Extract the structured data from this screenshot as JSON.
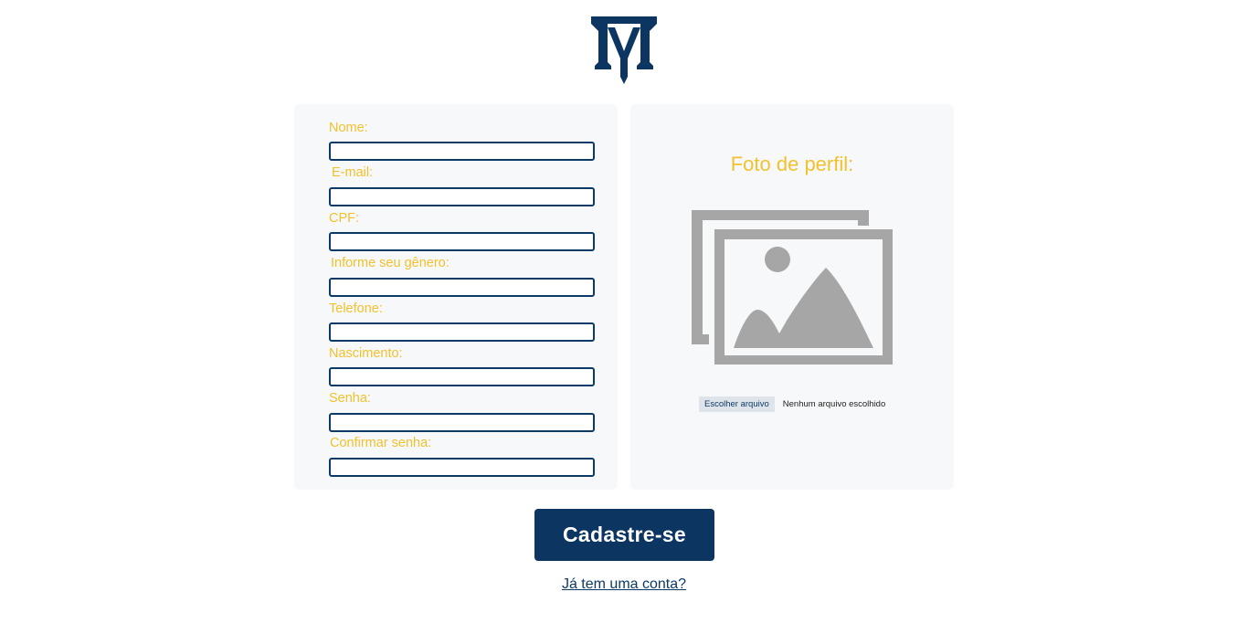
{
  "form": {
    "fields": [
      {
        "label": "Nome:",
        "value": ""
      },
      {
        "label": "E-mail:",
        "value": ""
      },
      {
        "label": "CPF:",
        "value": ""
      },
      {
        "label": "Informe seu gênero:",
        "value": ""
      },
      {
        "label": "Telefone:",
        "value": ""
      },
      {
        "label": "Nascimento:",
        "value": ""
      },
      {
        "label": "Senha:",
        "value": ""
      },
      {
        "label": "Confirmar senha:",
        "value": ""
      }
    ]
  },
  "photo": {
    "title": "Foto de perfil:",
    "icon": "image-placeholder-icon",
    "file_button_label": "Escolher arquivo",
    "file_status": "Nenhum arquivo escolhido"
  },
  "actions": {
    "submit_label": "Cadastre-se",
    "login_link": "Já tem uma conta?"
  },
  "colors": {
    "accent_yellow": "#f2c12e",
    "brand_navy": "#0c3561",
    "card_bg": "#f7f8f9"
  }
}
